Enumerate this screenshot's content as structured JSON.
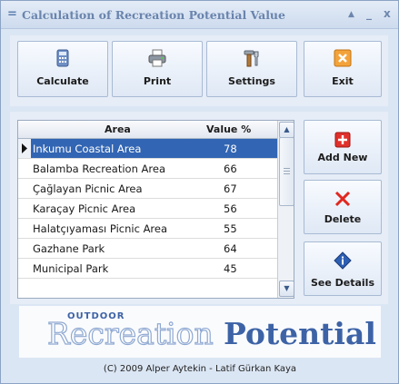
{
  "window": {
    "title": "Calculation of Recreation Potential Value",
    "menu_glyph": "=",
    "minimize_glyph": "_",
    "collapse_glyph": "▲",
    "close_glyph": "x"
  },
  "toolbar": {
    "calculate_label": "Calculate",
    "print_label": "Print",
    "settings_label": "Settings",
    "exit_label": "Exit"
  },
  "grid": {
    "columns": [
      "Area",
      "Value %"
    ],
    "rows": [
      {
        "area": "Inkumu Coastal Area",
        "value": "78",
        "selected": true
      },
      {
        "area": "Balamba Recreation Area",
        "value": "66"
      },
      {
        "area": "Çağlayan Picnic Area",
        "value": "67"
      },
      {
        "area": "Karaçay Picnic Area",
        "value": "56"
      },
      {
        "area": "Halatçıyaması Picnic Area",
        "value": "55"
      },
      {
        "area": "Gazhane Park",
        "value": "64"
      },
      {
        "area": "Municipal Park",
        "value": "45"
      }
    ]
  },
  "side_buttons": {
    "add_new_label": "Add New",
    "delete_label": "Delete",
    "see_details_label": "See Details"
  },
  "logo": {
    "small_text": "outdoor",
    "word1": "Recreation",
    "word2": "Potential"
  },
  "footer": {
    "copyright": "(C) 2009 Alper Aytekin - Latif Gürkan Kaya"
  },
  "colors": {
    "selection": "#3265b3",
    "logo_blue": "#3d63a6",
    "logo_light": "#9fb6d9"
  }
}
